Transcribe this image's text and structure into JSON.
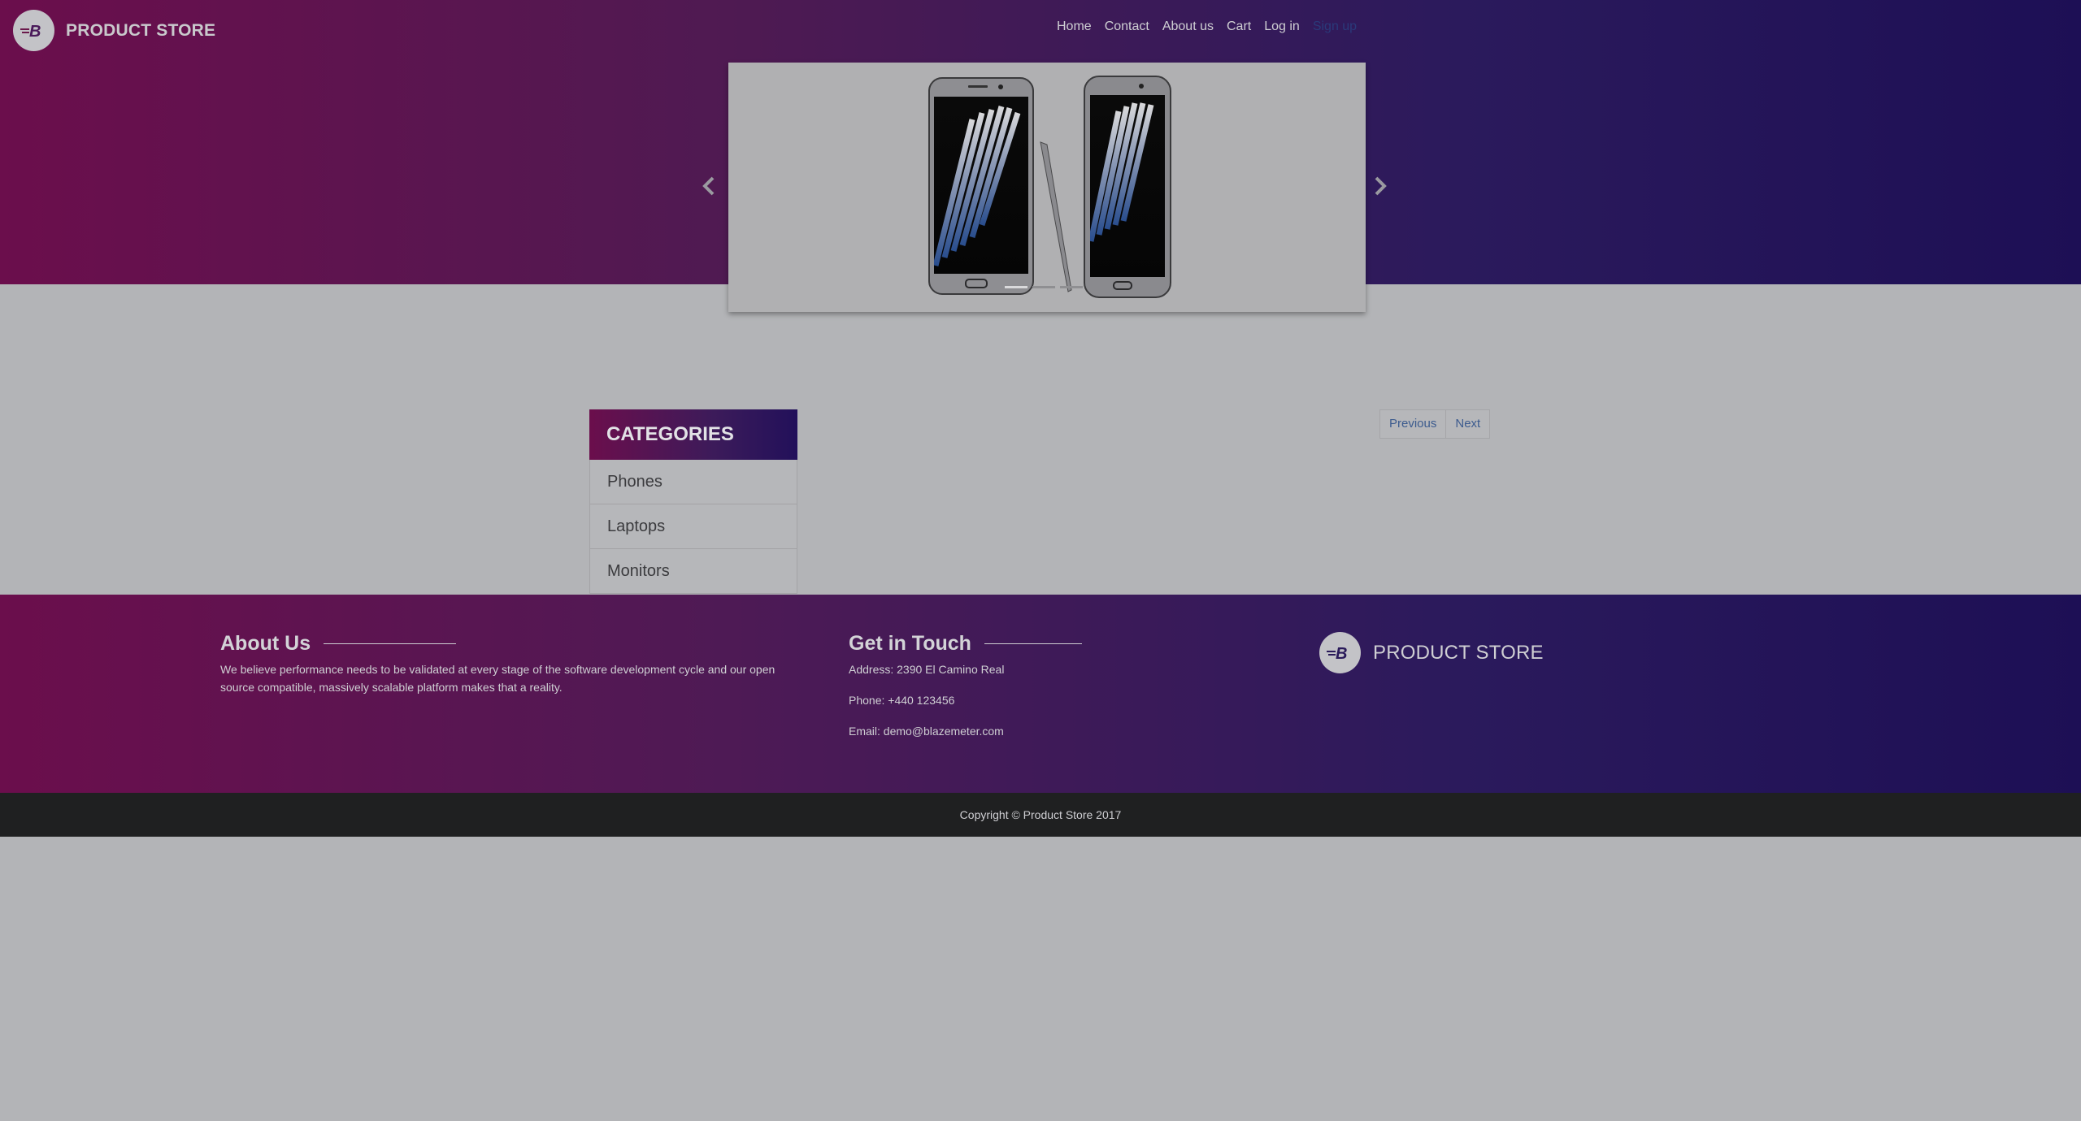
{
  "header": {
    "brand": "PRODUCT STORE",
    "nav": [
      "Home",
      "Contact",
      "About us",
      "Cart",
      "Log in",
      "Sign up"
    ]
  },
  "carousel": {
    "image": "samsung-galaxy-note-phones"
  },
  "categories": {
    "title": "CATEGORIES",
    "items": [
      "Phones",
      "Laptops",
      "Monitors"
    ]
  },
  "pagination": {
    "previous": "Previous",
    "next": "Next"
  },
  "footer": {
    "about_title": "About Us",
    "about_text": "We believe performance needs to be validated at every stage of the software development cycle and our open source compatible, massively scalable platform makes that a reality.",
    "contact_title": "Get in Touch",
    "address": "Address: 2390 El Camino Real",
    "phone": "Phone: +440 123456",
    "email": "Email: demo@blazemeter.com",
    "brand": "PRODUCT STORE",
    "copyright": "Copyright © Product Store 2017"
  },
  "colors": {
    "hero_start": "#6b0e4c",
    "hero_end": "#1d0f55",
    "page_bg": "#b3b4b7",
    "link_blue": "#3c5b8e",
    "copyright_bg": "#1f2021"
  }
}
